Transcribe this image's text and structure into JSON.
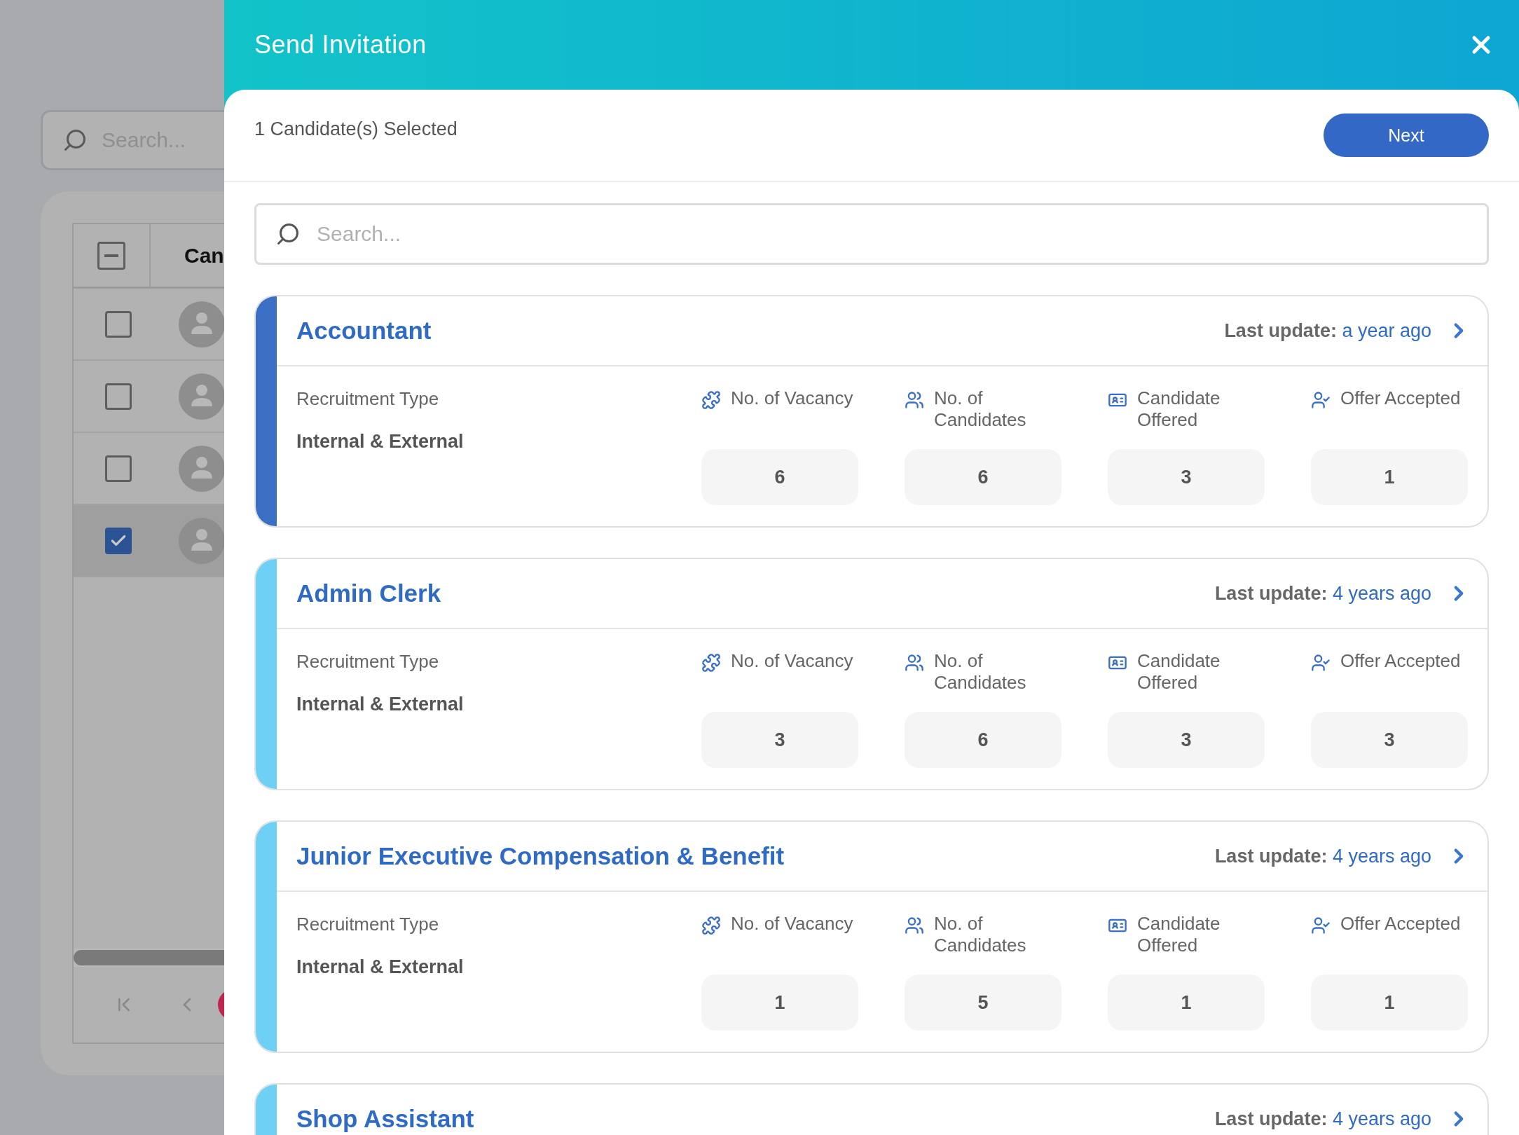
{
  "background": {
    "search": {
      "placeholder": "Search..."
    },
    "table": {
      "select_all": {
        "indeterminate": true
      },
      "column_1": "Can",
      "rows": [
        {
          "checked": false
        },
        {
          "checked": false
        },
        {
          "checked": false
        },
        {
          "checked": true
        }
      ]
    }
  },
  "dialog": {
    "title": "Send Invitation",
    "selection_count": "1 Candidate(s) Selected",
    "next_button": "Next",
    "search": {
      "placeholder": "Search..."
    },
    "jobs": [
      {
        "title": "Accountant",
        "selected": true,
        "last_update_label": "Last update:",
        "last_update": "a year ago",
        "recruitment_type_label": "Recruitment Type",
        "recruitment_type": "Internal & External",
        "stats": [
          {
            "kind": "vacancy",
            "label": "No. of Vacancy",
            "value": "6"
          },
          {
            "kind": "candidates",
            "label": "No. of Candidates",
            "value": "6"
          },
          {
            "kind": "offered",
            "label": "Candidate Offered",
            "value": "3"
          },
          {
            "kind": "accepted",
            "label": "Offer Accepted",
            "value": "1"
          }
        ]
      },
      {
        "title": "Admin Clerk",
        "selected": false,
        "last_update_label": "Last update:",
        "last_update": "4 years ago",
        "recruitment_type_label": "Recruitment Type",
        "recruitment_type": "Internal & External",
        "stats": [
          {
            "kind": "vacancy",
            "label": "No. of Vacancy",
            "value": "3"
          },
          {
            "kind": "candidates",
            "label": "No. of Candidates",
            "value": "6"
          },
          {
            "kind": "offered",
            "label": "Candidate Offered",
            "value": "3"
          },
          {
            "kind": "accepted",
            "label": "Offer Accepted",
            "value": "3"
          }
        ]
      },
      {
        "title": "Junior Executive Compensation & Benefit",
        "selected": false,
        "last_update_label": "Last update:",
        "last_update": "4 years ago",
        "recruitment_type_label": "Recruitment Type",
        "recruitment_type": "Internal & External",
        "stats": [
          {
            "kind": "vacancy",
            "label": "No. of Vacancy",
            "value": "1"
          },
          {
            "kind": "candidates",
            "label": "No. of Candidates",
            "value": "5"
          },
          {
            "kind": "offered",
            "label": "Candidate Offered",
            "value": "1"
          },
          {
            "kind": "accepted",
            "label": "Offer Accepted",
            "value": "1"
          }
        ]
      },
      {
        "title": "Shop Assistant",
        "selected": false,
        "last_update_label": "Last update:",
        "last_update": "4 years ago"
      }
    ]
  }
}
